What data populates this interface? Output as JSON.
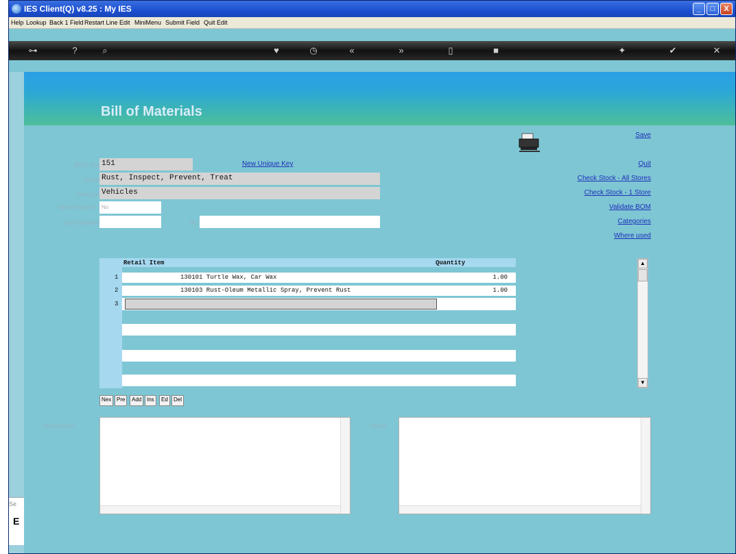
{
  "window": {
    "title": "IES Client(Q) v8.25 : My IES",
    "buttons": {
      "minimize": "_",
      "maximize": "□",
      "close": "X"
    }
  },
  "menu": [
    "Help",
    "Lookup",
    "Back 1 Field",
    "Restart Line Edit",
    "MiniMenu",
    "Submit Field",
    "Quit Edit"
  ],
  "toolbar": {
    "icons": [
      "key-icon",
      "help-icon",
      "search-icon",
      "heart-icon",
      "clock-icon",
      "rewind-icon",
      "forward-icon",
      "stop-icon",
      "square-icon",
      "gear-icon",
      "check-icon",
      "close-icon"
    ],
    "glyphs": [
      "⊶",
      "?",
      "⌕",
      "♥",
      "◷",
      "«",
      "»",
      "▯",
      "■",
      "✦",
      "✔",
      "✕"
    ]
  },
  "header": {
    "title": "Bill of Materials"
  },
  "form": {
    "bom_key_label": "BOM Key",
    "bom_key": "151",
    "new_unique_key": "New Unique Key",
    "name_label": "Name",
    "name": "Rust, Inspect, Prevent, Treat",
    "category_label": "Category",
    "category": "Vehicles",
    "need_serial_label": "Need Serial # ?",
    "need_serial": "No",
    "last_updated_label": "Last Updated",
    "last_updated": "",
    "by_label": "By",
    "by": ""
  },
  "actions": {
    "save": "Save",
    "quit": "Quit",
    "check_all": "Check Stock - All Stores",
    "check_one": "Check Stock - 1 Store",
    "validate": "Validate BOM",
    "categories": "Categories",
    "where_used": "Where used"
  },
  "grid": {
    "headers": {
      "item": "Retail Item",
      "qty": "Quantity"
    },
    "rows": [
      {
        "num": "1",
        "item": "130101 Turtle Wax, Car Wax",
        "qty": "1.00"
      },
      {
        "num": "2",
        "item": "130103 Rust-Oleum Metallic Spray, Prevent Rust",
        "qty": "1.00"
      },
      {
        "num": "3",
        "item": "",
        "qty": ""
      }
    ]
  },
  "grid_buttons": [
    "Nex",
    "Pre",
    "Add",
    "Ins",
    "Ed",
    "Del"
  ],
  "memo": {
    "instructions_label": "Instructions",
    "notes_label": "Notes"
  },
  "status": {
    "left_text": "Se",
    "left_glyph": "E"
  }
}
